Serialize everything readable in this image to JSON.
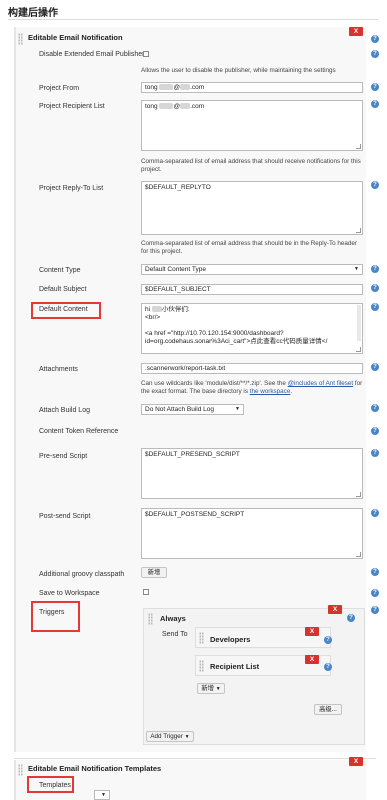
{
  "section_title": "构建后操作",
  "email_notification": {
    "title": "Editable Email Notification",
    "close_label": "X",
    "disable_publisher": {
      "label": "Disable Extended Email Publisher",
      "description": "Allows the user to disable the publisher, while maintaining the settings"
    },
    "project_from": {
      "label": "Project From",
      "value_prefix": "tong",
      "value_suffix": ".com"
    },
    "recipient_list": {
      "label": "Project Recipient List",
      "value_prefix": "tong",
      "value_suffix": ".com",
      "description": "Comma-separated list of email address that should receive notifications for this project."
    },
    "reply_to": {
      "label": "Project Reply-To List",
      "value": "$DEFAULT_REPLYTO",
      "description": "Comma-separated list of email address that should be in the Reply-To header for this project."
    },
    "content_type": {
      "label": "Content Type",
      "value": "Default Content Type"
    },
    "default_subject": {
      "label": "Default Subject",
      "value": "$DEFAULT_SUBJECT"
    },
    "default_content": {
      "label": "Default Content",
      "lines": [
        "hi ",
        "<br/>",
        "",
        "<a href =\"http://10.70.120.154:9000/dashboard?",
        "id=org.codehaus.sonar%3Aci_cart\">点此查看cc代码质量详情</"
      ],
      "line1_suffix": "小伙伴们:"
    },
    "attachments": {
      "label": "Attachments",
      "value": ".scannerwork/report-task.txt",
      "description_1": "Can use wildcards like 'module/dist/**/*.zip'. See the ",
      "includes_link": "@includes of Ant fileset",
      "description_2": " for the exact format. The base directory is ",
      "workspace_link": "the workspace",
      "description_3": "."
    },
    "attach_build_log": {
      "label": "Attach Build Log",
      "value": "Do Not Attach Build Log"
    },
    "content_token_reference": {
      "label": "Content Token Reference"
    },
    "pre_send_script": {
      "label": "Pre-send Script",
      "value": "$DEFAULT_PRESEND_SCRIPT"
    },
    "post_send_script": {
      "label": "Post-send Script",
      "value": "$DEFAULT_POSTSEND_SCRIPT"
    },
    "groovy_classpath": {
      "label": "Additional groovy classpath",
      "button": "新增"
    },
    "save_to_workspace": {
      "label": "Save to Workspace"
    },
    "triggers": {
      "label": "Triggers",
      "always": {
        "title": "Always",
        "send_to_label": "Send To",
        "developers": "Developers",
        "recipient_list": "Recipient List",
        "add_button": "新增",
        "advanced_button": "高级..."
      },
      "add_trigger_button": "Add Trigger"
    }
  },
  "templates_panel": {
    "title": "Editable Email Notification Templates",
    "close_label": "X",
    "templates_label": "Templates"
  },
  "colors": {
    "close_red": "#d9312b",
    "help_blue": "#4a86c6",
    "highlight_red": "#e53935",
    "link": "#2a5aa7"
  },
  "icons": {
    "help": "question-circle-icon",
    "drag": "drag-handle-icon",
    "dropdown": "caret-down-icon"
  }
}
